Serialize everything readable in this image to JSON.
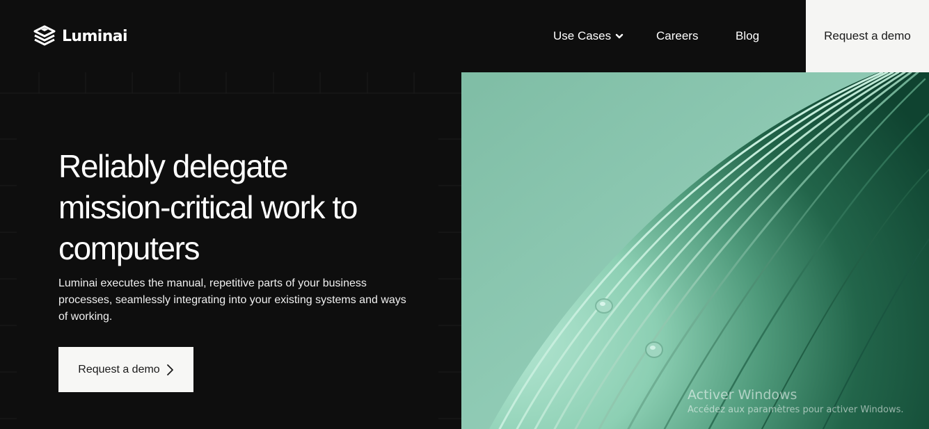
{
  "brand": {
    "name": "Luminai",
    "icon": "stacked-layers-logo-icon"
  },
  "nav": {
    "items": [
      {
        "label": "Use Cases",
        "has_dropdown": true,
        "icon": "chevron-down-icon"
      },
      {
        "label": "Careers"
      },
      {
        "label": "Blog"
      }
    ],
    "cta_label": "Request a demo"
  },
  "hero": {
    "title_lines": [
      "Reliably delegate",
      "mission-critical work to",
      "computers"
    ],
    "description": "Luminai executes the manual, repetitive parts of your business processes, seamlessly integrating into your existing systems and ways of working.",
    "cta_label": "Request a demo",
    "cta_icon": "chevron-right-icon",
    "image": "green-ribbed-dome-render"
  },
  "watermark": {
    "title": "Activer Windows",
    "subtitle": "Accédez aux paramètres pour activer Windows."
  },
  "colors": {
    "background": "#0e0e0e",
    "text": "#ffffff",
    "cta_background": "#f5f5f3",
    "cta_text": "#1a1a1a",
    "mint": "#8ec9b2",
    "deep_green": "#14503a"
  }
}
